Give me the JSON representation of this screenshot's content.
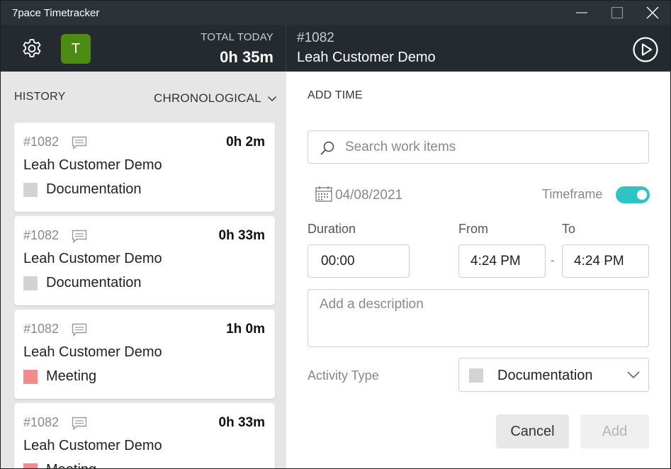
{
  "window": {
    "title": "7pace Timetracker"
  },
  "header": {
    "avatar_letter": "T",
    "avatar_color": "#4c8c12",
    "total_label": "TOTAL TODAY",
    "total_value": "0h 35m",
    "current_id": "#1082",
    "current_title": "Leah Customer Demo"
  },
  "history": {
    "title": "HISTORY",
    "sort_label": "CHRONOLOGICAL",
    "cards": [
      {
        "id": "#1082",
        "duration": "0h 2m",
        "title": "Leah Customer Demo",
        "activity": "Documentation",
        "activity_color": "#d3d3d3"
      },
      {
        "id": "#1082",
        "duration": "0h 33m",
        "title": "Leah Customer Demo",
        "activity": "Documentation",
        "activity_color": "#d3d3d3"
      },
      {
        "id": "#1082",
        "duration": "1h 0m",
        "title": "Leah Customer Demo",
        "activity": "Meeting",
        "activity_color": "#f28b8b"
      },
      {
        "id": "#1082",
        "duration": "0h 33m",
        "title": "Leah Customer Demo",
        "activity": "Meeting",
        "activity_color": "#f28b8b"
      }
    ]
  },
  "add_time": {
    "title": "ADD TIME",
    "search_placeholder": "Search work items",
    "date": "04/08/2021",
    "timeframe_label": "Timeframe",
    "timeframe_on": true,
    "duration_label": "Duration",
    "duration_value": "00:00",
    "from_label": "From",
    "from_value": "4:24 PM",
    "to_label": "To",
    "to_value": "4:24 PM",
    "range_separator": "-",
    "description_placeholder": "Add a description",
    "activity_type_label": "Activity Type",
    "activity_type_value": "Documentation",
    "activity_type_color": "#d3d3d3",
    "cancel_label": "Cancel",
    "add_label": "Add"
  },
  "colors": {
    "accent_toggle": "#2ec4c6",
    "header_bg": "#252a31"
  }
}
